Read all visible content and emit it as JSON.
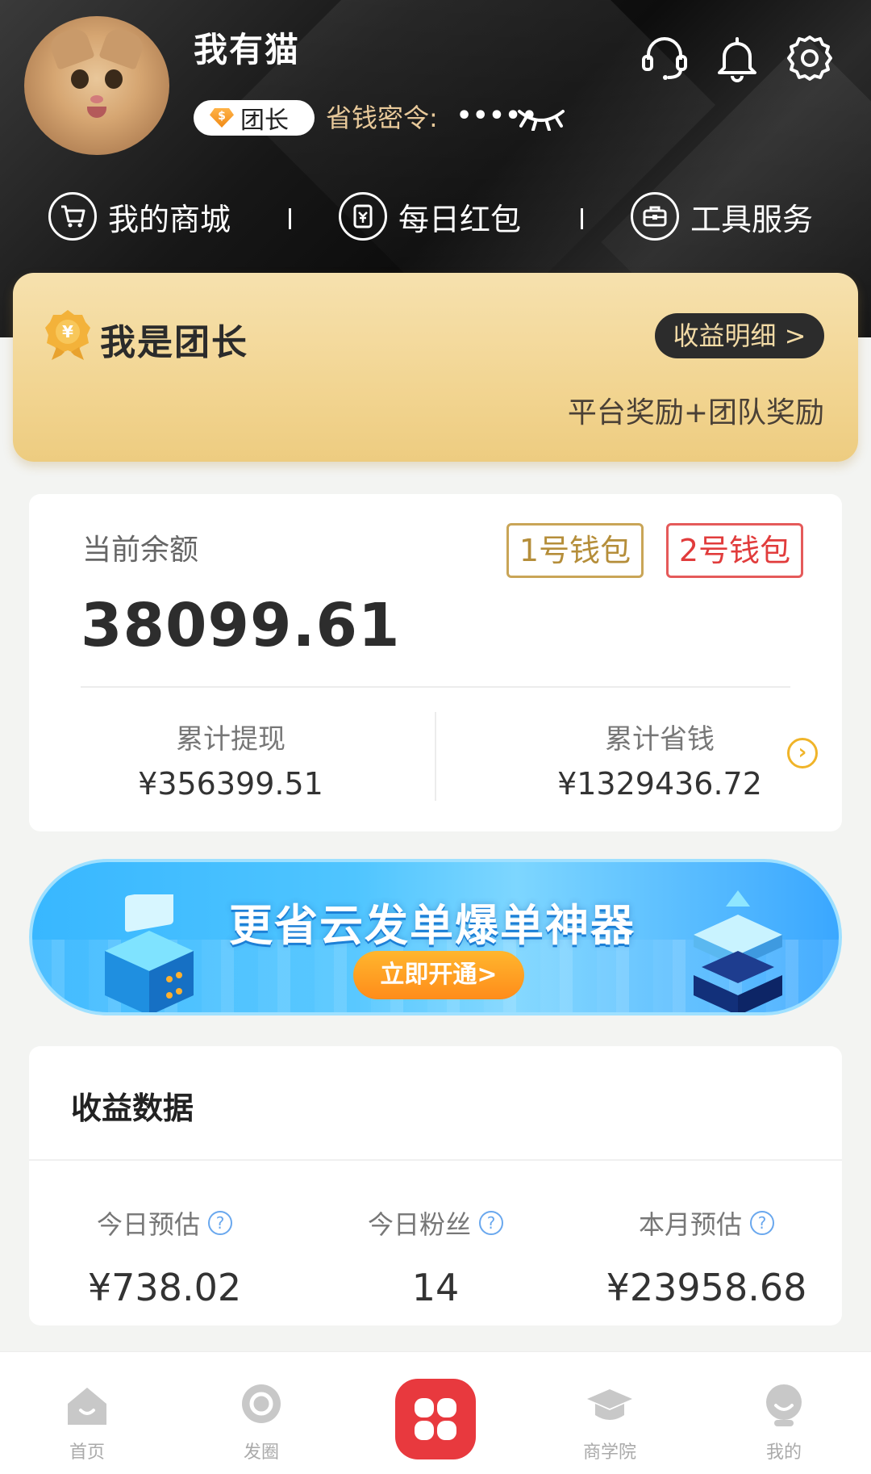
{
  "profile": {
    "username": "我有猫",
    "badge": "团长",
    "secret_label": "省钱密令:",
    "secret_value": "•••••"
  },
  "quick_nav": [
    {
      "label": "我的商城",
      "icon": "cart-icon"
    },
    {
      "label": "每日红包",
      "icon": "redpack-icon"
    },
    {
      "label": "工具服务",
      "icon": "toolbox-icon"
    }
  ],
  "leader_card": {
    "title": "我是团长",
    "detail_button": "收益明细 >",
    "subtitle": "平台奖励+团队奖励"
  },
  "balance": {
    "label": "当前余额",
    "value": "38099.61",
    "wallet1": "1号钱包",
    "wallet2": "2号钱包",
    "total_withdraw_label": "累计提现",
    "total_withdraw_value": "¥356399.51",
    "total_saved_label": "累计省钱",
    "total_saved_value": "¥1329436.72"
  },
  "banner": {
    "title": "更省云发单爆单神器",
    "button": "立即开通>"
  },
  "income": {
    "title": "收益数据",
    "items": [
      {
        "label": "今日预估",
        "value": "¥738.02"
      },
      {
        "label": "今日粉丝",
        "value": "14"
      },
      {
        "label": "本月预估",
        "value": "¥23958.68"
      }
    ]
  },
  "tabbar": {
    "items": [
      {
        "label": "首页",
        "icon": "home-icon"
      },
      {
        "label": "发圈",
        "icon": "circle-icon"
      },
      {
        "label": "",
        "icon": "center-grid-icon"
      },
      {
        "label": "商学院",
        "icon": "mortarboard-icon"
      },
      {
        "label": "我的",
        "icon": "profile-icon"
      }
    ]
  },
  "colors": {
    "gold_accent": "#f2d592",
    "wallet2_red": "#e13c3c",
    "center_tab_red": "#e8393e",
    "banner_blue": "#38b7ff"
  }
}
